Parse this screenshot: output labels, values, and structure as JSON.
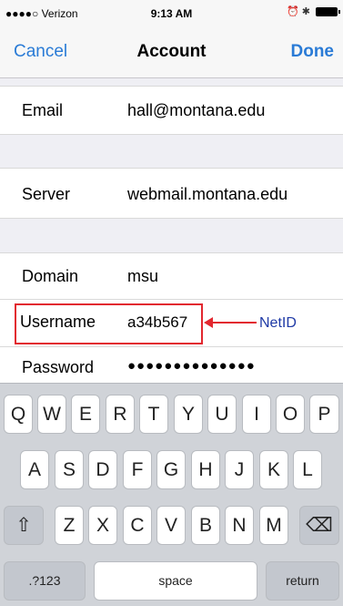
{
  "status_bar": {
    "carrier": "●●●●○ Verizon",
    "time": "9:13 AM",
    "right_icons": "⏰ ✱"
  },
  "nav": {
    "cancel": "Cancel",
    "title": "Account",
    "done": "Done"
  },
  "fields": {
    "email": {
      "label": "Email",
      "value": "hall@montana.edu"
    },
    "server": {
      "label": "Server",
      "value": "webmail.montana.edu"
    },
    "domain": {
      "label": "Domain",
      "value": "msu"
    },
    "username": {
      "label": "Username",
      "value": "a34b567"
    },
    "password": {
      "label": "Password",
      "value": "●●●●●●●●●●●●●●"
    }
  },
  "annotation": {
    "text": "NetID",
    "color": "#1f3aa6",
    "box_color": "#e2272f"
  },
  "keyboard": {
    "row1": [
      "Q",
      "W",
      "E",
      "R",
      "T",
      "Y",
      "U",
      "I",
      "O",
      "P"
    ],
    "row2": [
      "A",
      "S",
      "D",
      "F",
      "G",
      "H",
      "J",
      "K",
      "L"
    ],
    "row3": [
      "Z",
      "X",
      "C",
      "V",
      "B",
      "N",
      "M"
    ],
    "shift": "⇧",
    "delete": "⌫",
    "numbers": ".?123",
    "space": "space",
    "return": "return"
  }
}
